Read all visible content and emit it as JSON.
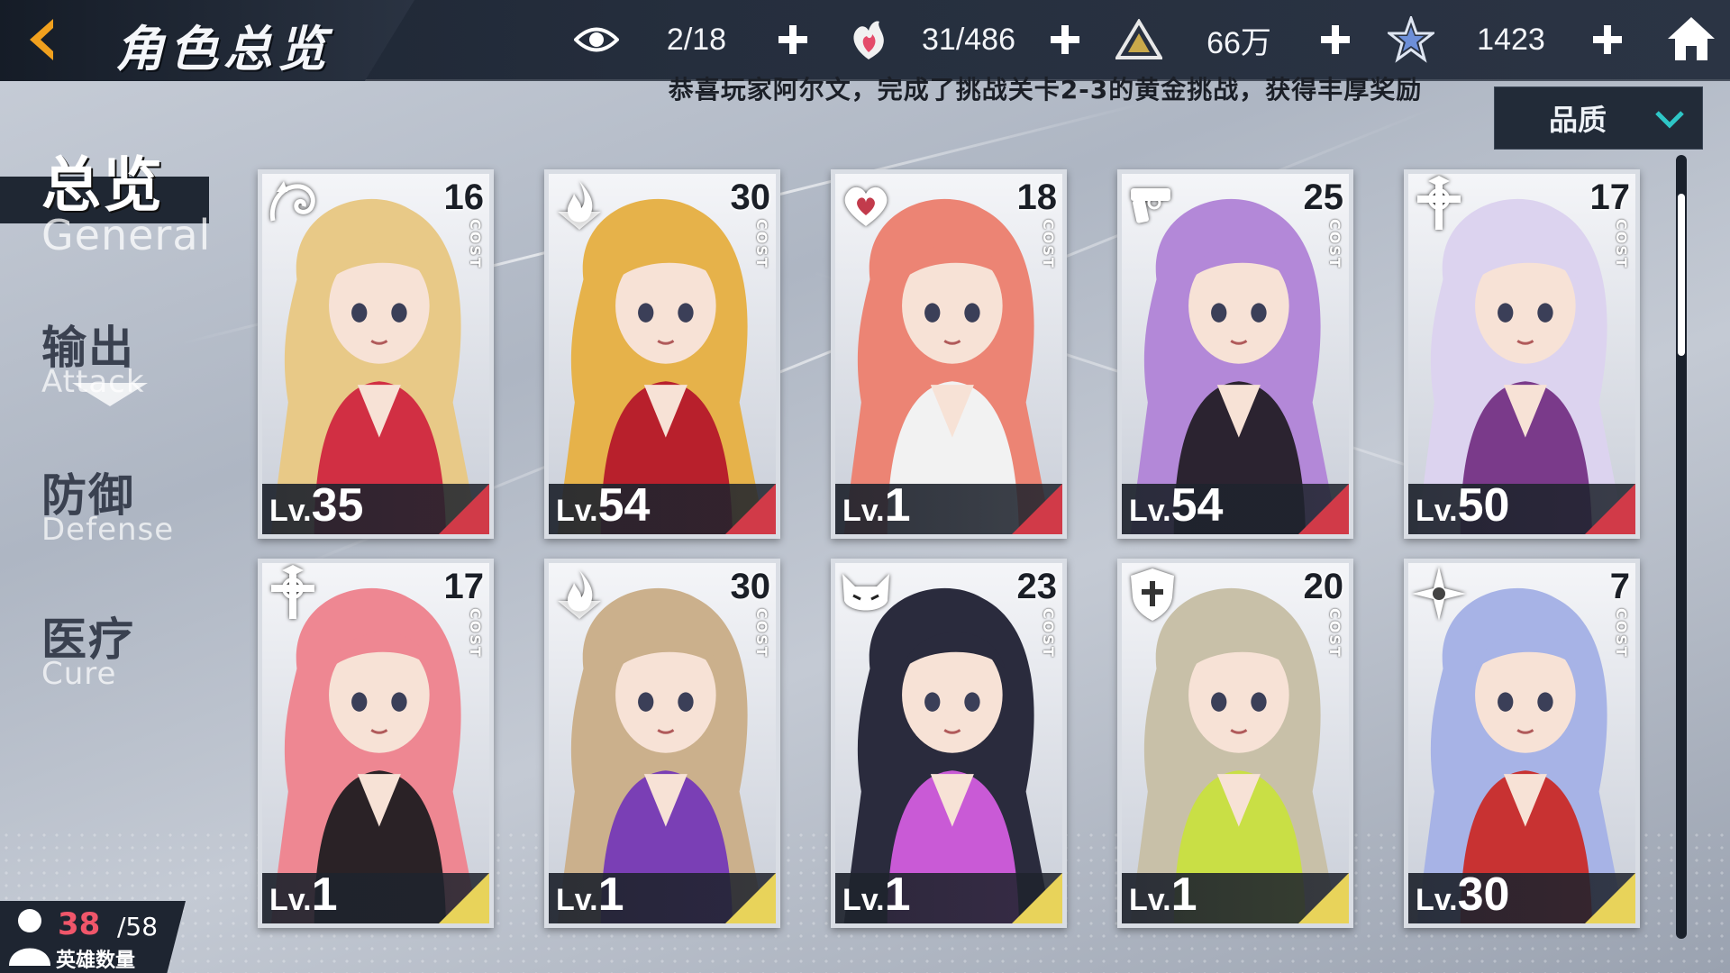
{
  "header": {
    "title": "角色总览",
    "resources": [
      {
        "icon": "eye-icon",
        "value": "2/18"
      },
      {
        "icon": "heart-flame-icon",
        "value": "31/486"
      },
      {
        "icon": "triangle-emblem-icon",
        "value": "66万"
      },
      {
        "icon": "star-crystal-icon",
        "value": "1423"
      }
    ]
  },
  "notice": "恭喜玩家阿尔文，完成了挑战关卡2-3的黄金挑战，获得丰厚奖励",
  "sort": {
    "label": "品质"
  },
  "nav": [
    {
      "cn": "总览",
      "en": "General",
      "active": true
    },
    {
      "cn": "输出",
      "en": "Attack",
      "active": false
    },
    {
      "cn": "防御",
      "en": "Defense",
      "active": false
    },
    {
      "cn": "医疗",
      "en": "Cure",
      "active": false
    }
  ],
  "hero_count": {
    "current": "38",
    "max": "/58",
    "label": "英雄数量"
  },
  "cost_label": "COST",
  "lv_prefix": "Lv.",
  "cards": [
    {
      "cost": "16",
      "level": "35",
      "class_icon": "dragon-class-icon",
      "hair": "#e8c987",
      "accent": "#d12f43",
      "corner": "#d13a48"
    },
    {
      "cost": "30",
      "level": "54",
      "class_icon": "flame-class-icon",
      "hair": "#e6b24a",
      "accent": "#b8202c",
      "corner": "#d13a48"
    },
    {
      "cost": "18",
      "level": "1",
      "class_icon": "heart-class-icon",
      "hair": "#ec8474",
      "accent": "#f2f2f2",
      "corner": "#d13a48"
    },
    {
      "cost": "25",
      "level": "54",
      "class_icon": "gun-class-icon",
      "hair": "#b388d8",
      "accent": "#2b2330",
      "corner": "#d13a48"
    },
    {
      "cost": "17",
      "level": "50",
      "class_icon": "cross-class-icon",
      "hair": "#dcd3ef",
      "accent": "#7a3a8a",
      "corner": "#d13a48"
    },
    {
      "cost": "17",
      "level": "1",
      "class_icon": "cross-class-icon",
      "hair": "#ee8792",
      "accent": "#2a2226",
      "corner": "#e8d35a"
    },
    {
      "cost": "30",
      "level": "1",
      "class_icon": "flame-class-icon",
      "hair": "#cbb08c",
      "accent": "#7a3fb5",
      "corner": "#e8d35a"
    },
    {
      "cost": "23",
      "level": "1",
      "class_icon": "fox-mask-class-icon",
      "hair": "#2a2b3d",
      "accent": "#c95ad6",
      "corner": "#e8d35a"
    },
    {
      "cost": "20",
      "level": "1",
      "class_icon": "shield-class-icon",
      "hair": "#c8c0a8",
      "accent": "#c9df45",
      "corner": "#e8d35a"
    },
    {
      "cost": "7",
      "level": "30",
      "class_icon": "shuriken-class-icon",
      "hair": "#a7b3e6",
      "accent": "#c83232",
      "corner": "#e8d35a"
    }
  ]
}
